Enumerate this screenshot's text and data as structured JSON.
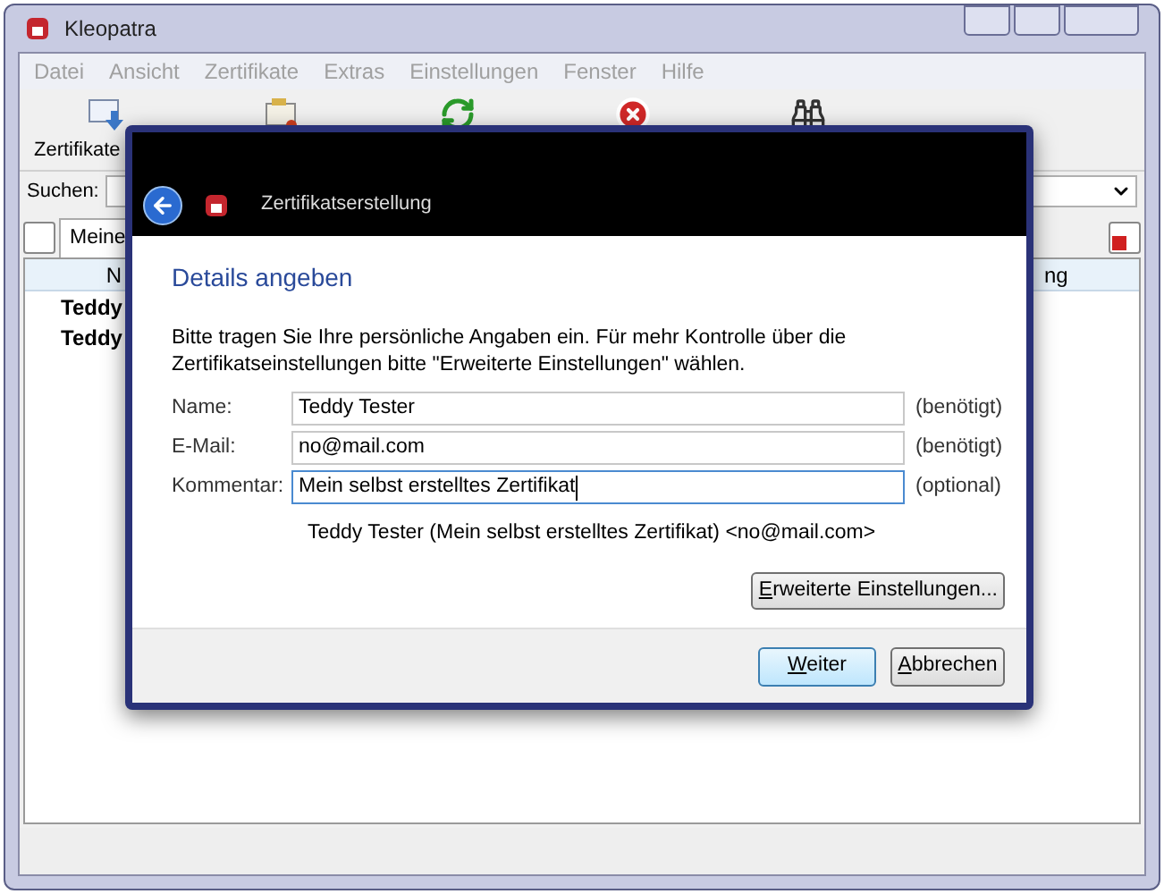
{
  "window": {
    "title": "Kleopatra"
  },
  "menu": [
    {
      "label": "Datei",
      "disabled": true
    },
    {
      "label": "Ansicht",
      "disabled": true
    },
    {
      "label": "Zertifikate",
      "disabled": true
    },
    {
      "label": "Extras",
      "disabled": true
    },
    {
      "label": "Einstellungen",
      "disabled": true
    },
    {
      "label": "Fenster",
      "disabled": true
    },
    {
      "label": "Hilfe",
      "disabled": true
    }
  ],
  "toolbar": [
    {
      "kind": "import",
      "label": "Zertifikate"
    },
    {
      "kind": "export"
    },
    {
      "kind": "reload"
    },
    {
      "kind": "stop"
    },
    {
      "kind": "lookup"
    }
  ],
  "search": {
    "label": "Suchen:"
  },
  "tabs": [
    {
      "label": "Meine",
      "selected": true
    }
  ],
  "table": {
    "columns": [
      "N",
      "ng"
    ],
    "rows": [
      [
        "Teddy"
      ],
      [
        "Teddy"
      ]
    ]
  },
  "dialog": {
    "title": "Zertifikatserstellung",
    "heading": "Details angeben",
    "intro": "Bitte tragen Sie Ihre persönliche Angaben ein. Für mehr Kontrolle über die Zertifikatseinstellungen bitte \"Erweiterte Einstellungen\" wählen.",
    "fields": [
      {
        "label": "Name:",
        "value": "Teddy Tester",
        "note": "(benötigt)",
        "focused": false
      },
      {
        "label": "E-Mail:",
        "value": "no@mail.com",
        "note": "(benötigt)",
        "focused": false
      },
      {
        "label": "Kommentar:",
        "value": "Mein selbst erstelltes Zertifikat",
        "note": "(optional)",
        "focused": true
      }
    ],
    "preview": "Teddy Tester (Mein selbst erstelltes Zertifikat) <no@mail.com>",
    "advanced_button": "Erweiterte Einstellungen...",
    "buttons": [
      {
        "label": "Weiter",
        "default": true
      },
      {
        "label": "Abbrechen",
        "default": false
      }
    ]
  }
}
